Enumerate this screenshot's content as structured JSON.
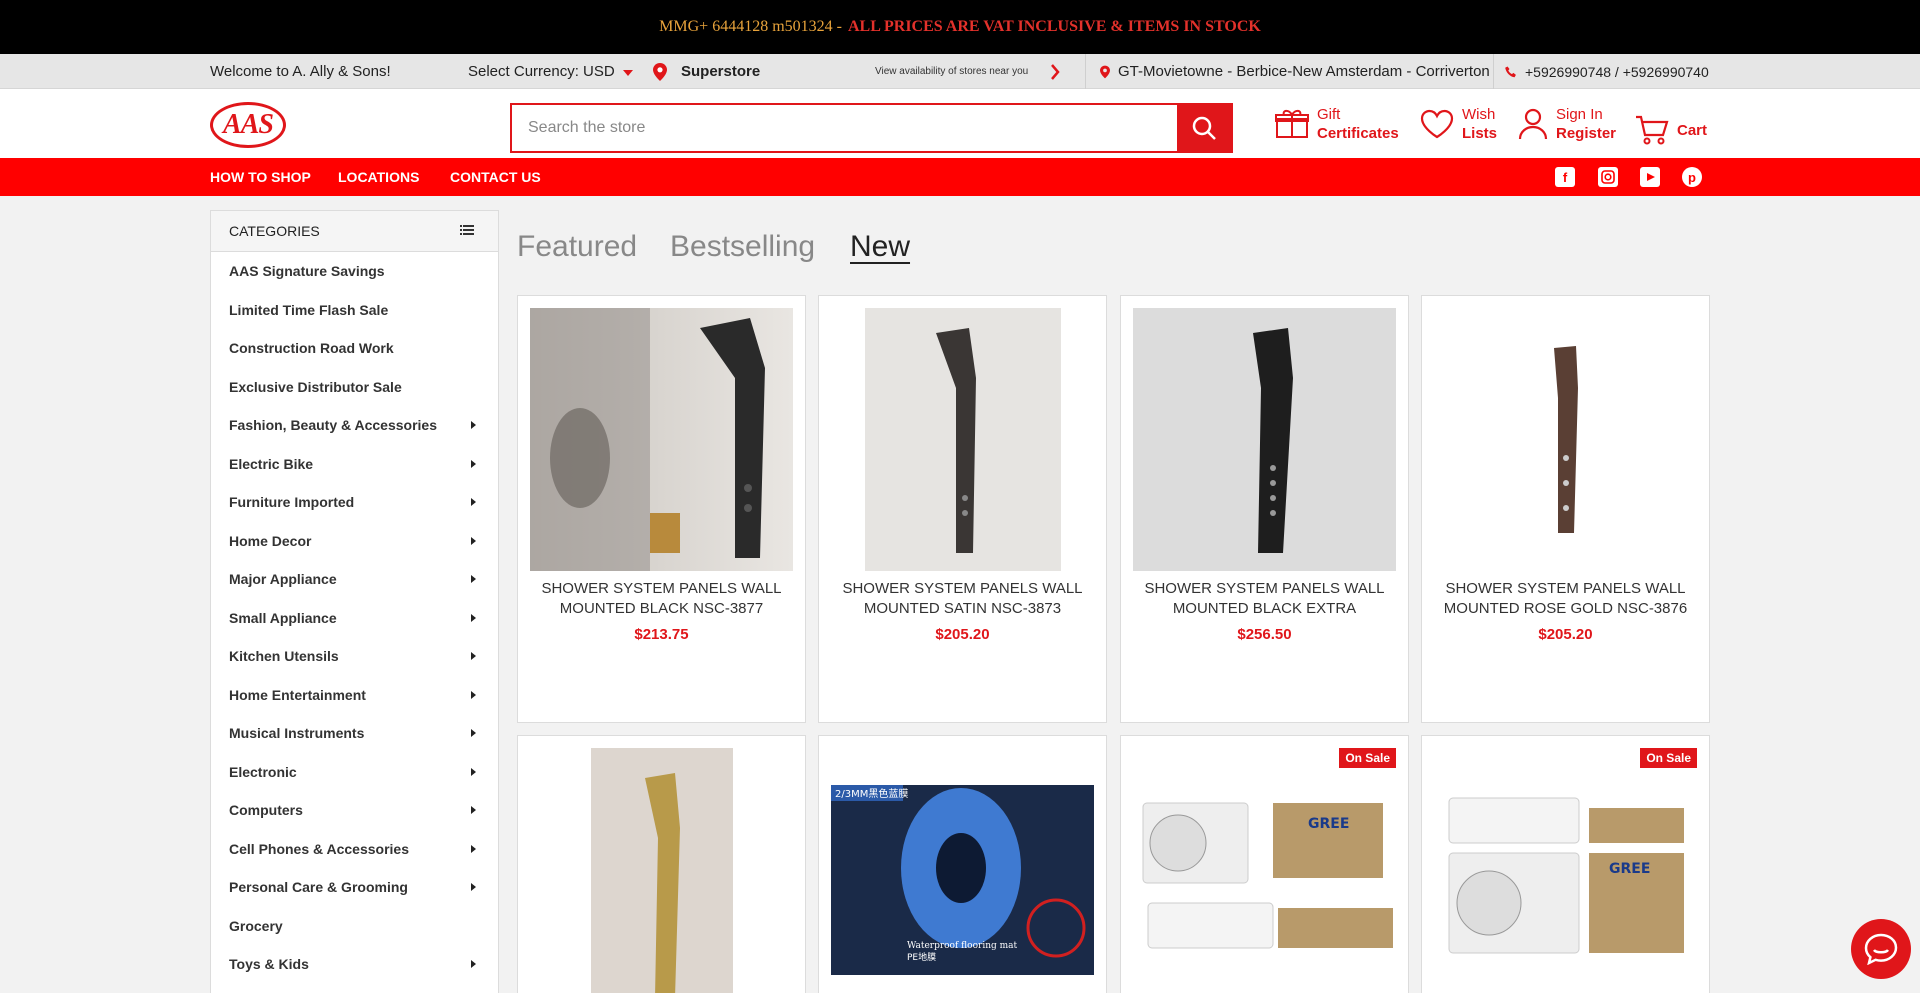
{
  "promo": {
    "code": "MMG+ 6444128 m501324 -",
    "message": "ALL PRICES ARE VAT INCLUSIVE & ITEMS IN STOCK"
  },
  "utility": {
    "welcome": "Welcome to A. Ally & Sons!",
    "currency": "Select Currency: USD",
    "store": "Superstore",
    "availability": "View availability of stores near you",
    "locations": "GT-Movietowne - Berbice-New Amsterdam - Corriverton",
    "phones": "+5926990748 / +5926990740"
  },
  "header": {
    "logo_text": "AAS",
    "search_placeholder": "Search the store",
    "gift": {
      "line1": "Gift",
      "line2": "Certificates"
    },
    "wish": {
      "line1": "Wish",
      "line2": "Lists"
    },
    "account": {
      "line1": "Sign In",
      "line2": "Register"
    },
    "cart": "Cart"
  },
  "nav": {
    "items": [
      "HOW TO SHOP",
      "LOCATIONS",
      "CONTACT US"
    ]
  },
  "sidebar": {
    "title": "CATEGORIES",
    "categories": [
      {
        "label": "AAS Signature Savings",
        "sub": false
      },
      {
        "label": "Limited Time Flash Sale",
        "sub": false
      },
      {
        "label": "Construction Road Work",
        "sub": false
      },
      {
        "label": "Exclusive Distributor Sale",
        "sub": false
      },
      {
        "label": "Fashion, Beauty & Accessories",
        "sub": true
      },
      {
        "label": "Electric Bike",
        "sub": true
      },
      {
        "label": "Furniture Imported",
        "sub": true
      },
      {
        "label": "Home Decor",
        "sub": true
      },
      {
        "label": "Major Appliance",
        "sub": true
      },
      {
        "label": "Small Appliance",
        "sub": true
      },
      {
        "label": "Kitchen Utensils",
        "sub": true
      },
      {
        "label": "Home Entertainment",
        "sub": true
      },
      {
        "label": "Musical Instruments",
        "sub": true
      },
      {
        "label": "Electronic",
        "sub": true
      },
      {
        "label": "Computers",
        "sub": true
      },
      {
        "label": "Cell Phones & Accessories",
        "sub": true
      },
      {
        "label": "Personal Care & Grooming",
        "sub": true
      },
      {
        "label": "Grocery",
        "sub": false
      },
      {
        "label": "Toys & Kids",
        "sub": true
      }
    ]
  },
  "tabs": [
    "Featured",
    "Bestselling",
    "New"
  ],
  "active_tab": "New",
  "products": [
    {
      "name": "SHOWER SYSTEM PANELS WALL MOUNTED BLACK NSC-3877",
      "price": "$213.75",
      "sale": "",
      "image": "shower-panel-black-bathroom"
    },
    {
      "name": "SHOWER SYSTEM PANELS WALL MOUNTED SATIN NSC-3873",
      "price": "$205.20",
      "sale": "",
      "image": "shower-panel-satin"
    },
    {
      "name": "SHOWER SYSTEM PANELS WALL MOUNTED BLACK EXTRA CONTROL...",
      "price": "$256.50",
      "sale": "",
      "image": "shower-panel-black-extra"
    },
    {
      "name": "SHOWER SYSTEM PANELS WALL MOUNTED ROSE GOLD NSC-3876",
      "price": "$205.20",
      "sale": "",
      "image": "shower-panel-rose-gold"
    },
    {
      "name": "",
      "price": "",
      "sale": "",
      "image": "shower-panel-gold"
    },
    {
      "name": "",
      "price": "",
      "sale": "",
      "image": "waterproof-flooring-mat",
      "image_caption": "2/3MM黑色蓝膜",
      "image_caption2": "Waterproof flooring mat",
      "image_caption3": "PE地膜"
    },
    {
      "name": "",
      "price": "",
      "sale": "On Sale",
      "image": "gree-air-conditioner",
      "brand": "GREE"
    },
    {
      "name": "",
      "price": "",
      "sale": "On Sale",
      "image": "gree-air-conditioner-2",
      "brand": "GREE"
    }
  ],
  "colors": {
    "brand_red": "#e0161a",
    "nav_red": "#ff0000",
    "promo_orange": "#e8a33b"
  }
}
